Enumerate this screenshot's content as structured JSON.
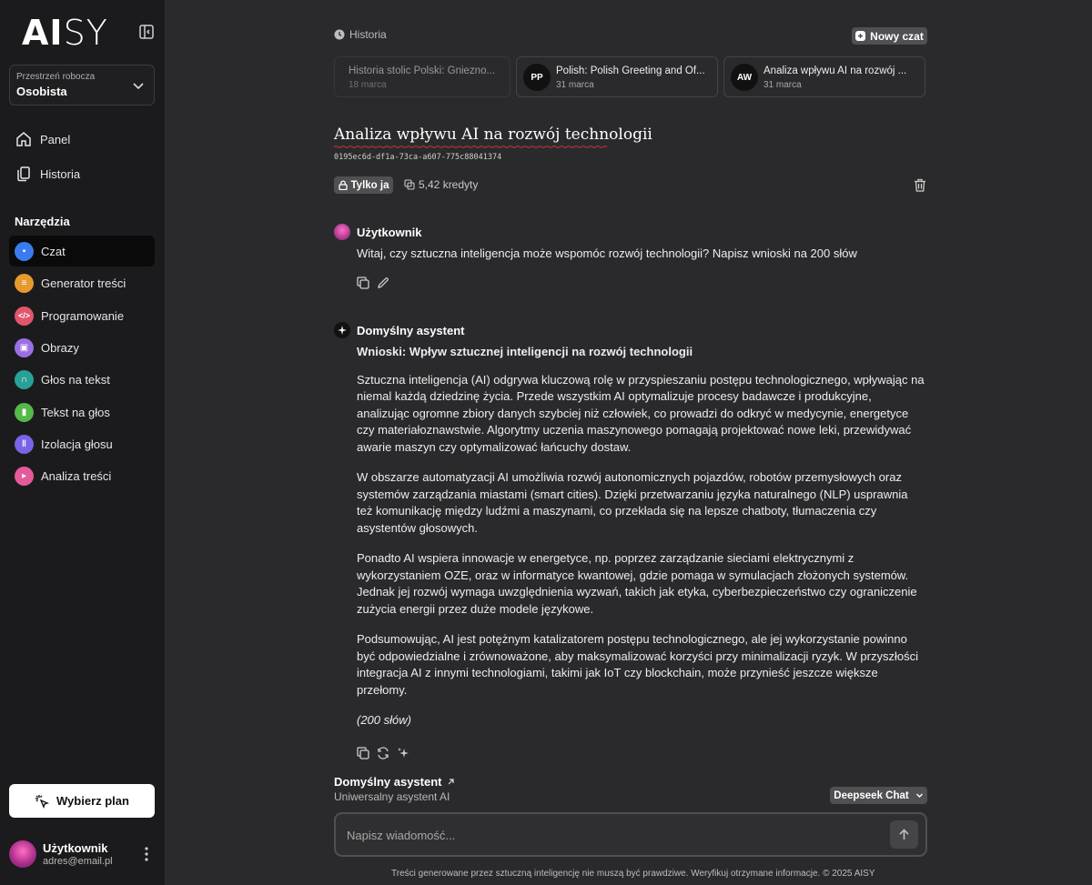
{
  "brand": {
    "logo_bold": "AI",
    "logo_light": "SY"
  },
  "workspace": {
    "label": "Przestrzeń robocza",
    "value": "Osobista"
  },
  "nav": [
    {
      "label": "Panel"
    },
    {
      "label": "Historia"
    }
  ],
  "tools": {
    "title": "Narzędzia",
    "items": [
      {
        "label": "Czat",
        "color": "#3a7bf0"
      },
      {
        "label": "Generator treści",
        "color": "#e69a2e"
      },
      {
        "label": "Programowanie",
        "color": "#e0566b"
      },
      {
        "label": "Obrazy",
        "color": "#9b6ee6"
      },
      {
        "label": "Głos na tekst",
        "color": "#2aa198"
      },
      {
        "label": "Tekst na głos",
        "color": "#55b84a"
      },
      {
        "label": "Izolacja głosu",
        "color": "#7a63e6"
      },
      {
        "label": "Analiza treści",
        "color": "#e55a9a"
      }
    ]
  },
  "plan_button": "Wybierz plan",
  "user": {
    "name": "Użytkownik",
    "email": "adres@email.pl"
  },
  "top": {
    "history_label": "Historia",
    "new_chat": "Nowy czat"
  },
  "recent_chats": [
    {
      "title": "Historia stolic Polski: Gniezno...",
      "date": "18 marca",
      "initials": ""
    },
    {
      "title": "Polish: Polish Greeting and Of...",
      "date": "31 marca",
      "initials": "PP"
    },
    {
      "title": "Analiza wpływu AI na rozwój ...",
      "date": "31 marca",
      "initials": "AW"
    }
  ],
  "chat": {
    "title": "Analiza wpływu AI na rozwój technologii",
    "id": "0195ec6d-df1a-73ca-a607-775c88041374",
    "visibility": "Tylko ja",
    "credits": "5,42 kredyty"
  },
  "user_message": {
    "author": "Użytkownik",
    "text": "Witaj, czy sztuczna inteligencja może wspomóc rozwój technologii? Napisz wnioski na 200 słów"
  },
  "assistant_message": {
    "author": "Domyślny asystent",
    "heading": "Wnioski: Wpływ sztucznej inteligencji na rozwój technologii",
    "paragraphs": [
      "Sztuczna inteligencja (AI) odgrywa kluczową rolę w przyspieszaniu postępu technologicznego, wpływając na niemal każdą dziedzinę życia. Przede wszystkim AI optymalizuje procesy badawcze i produkcyjne, analizując ogromne zbiory danych szybciej niż człowiek, co prowadzi do odkryć w medycynie, energetyce czy materiałoznawstwie. Algorytmy uczenia maszynowego pomagają projektować nowe leki, przewidywać awarie maszyn czy optymalizować łańcuchy dostaw.",
      "W obszarze automatyzacji AI umożliwia rozwój autonomicznych pojazdów, robotów przemysłowych oraz systemów zarządzania miastami (smart cities). Dzięki przetwarzaniu języka naturalnego (NLP) usprawnia też komunikację między ludźmi a maszynami, co przekłada się na lepsze chatboty, tłumaczenia czy asystentów głosowych.",
      "Ponadto AI wspiera innowacje w energetyce, np. poprzez zarządzanie sieciami elektrycznymi z wykorzystaniem OZE, oraz w informatyce kwantowej, gdzie pomaga w symulacjach złożonych systemów. Jednak jej rozwój wymaga uwzględnienia wyzwań, takich jak etyka, cyberbezpieczeństwo czy ograniczenie zużycia energii przez duże modele językowe.",
      "Podsumowując, AI jest potężnym katalizatorem postępu technologicznego, ale jej wykorzystanie powinno być odpowiedzialne i zrównoważone, aby maksymalizować korzyści przy minimalizacji ryzyk. W przyszłości integracja AI z innymi technologiami, takimi jak IoT czy blockchain, może przynieść jeszcze większe przełomy."
    ],
    "word_count": "(200 słów)"
  },
  "composer": {
    "assistant_name": "Domyślny asystent",
    "assistant_desc": "Uniwersalny asystent AI",
    "model": "Deepseek Chat",
    "placeholder": "Napisz wiadomość..."
  },
  "footer": "Treści generowane przez sztuczną inteligencję nie muszą być prawdziwe. Weryfikuj otrzymane informacje. © 2025 AISY"
}
